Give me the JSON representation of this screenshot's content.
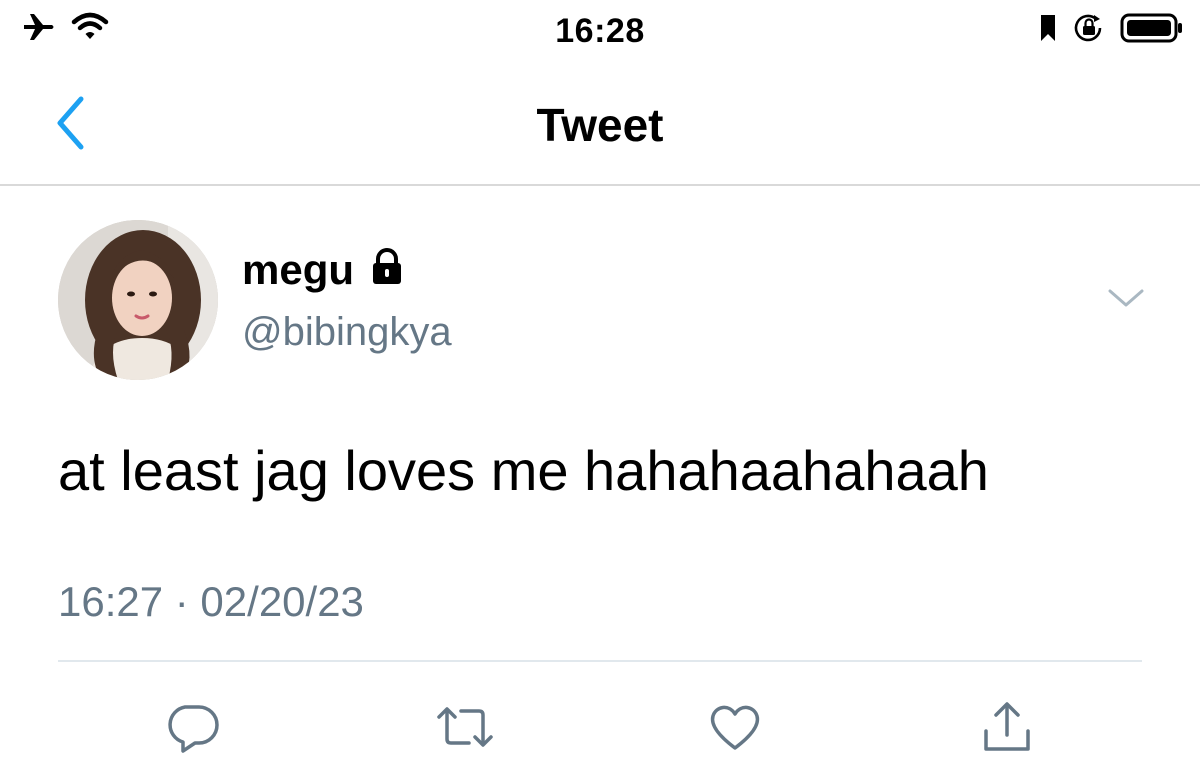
{
  "status_bar": {
    "time": "16:28",
    "icons": [
      "airplane-icon",
      "wifi-icon",
      "bookmark-icon",
      "rotation-lock-icon",
      "battery-icon"
    ]
  },
  "nav": {
    "title": "Tweet",
    "back_icon": "chevron-left-icon",
    "accent_color": "#1DA1F2"
  },
  "tweet": {
    "author": {
      "name": "megu",
      "handle": "@bibingkya",
      "protected_icon": "lock-icon"
    },
    "text": "at least jag loves me hahahaahahaah",
    "meta": "16:27 · 02/20/23",
    "menu_icon": "chevron-down-icon"
  },
  "actions": [
    {
      "name": "reply",
      "icon": "reply-icon"
    },
    {
      "name": "retweet",
      "icon": "retweet-icon"
    },
    {
      "name": "like",
      "icon": "heart-icon"
    },
    {
      "name": "share",
      "icon": "share-icon"
    }
  ],
  "colors": {
    "secondary_text": "#657786",
    "icon_gray": "#657786",
    "divider": "#E1E8ED"
  }
}
